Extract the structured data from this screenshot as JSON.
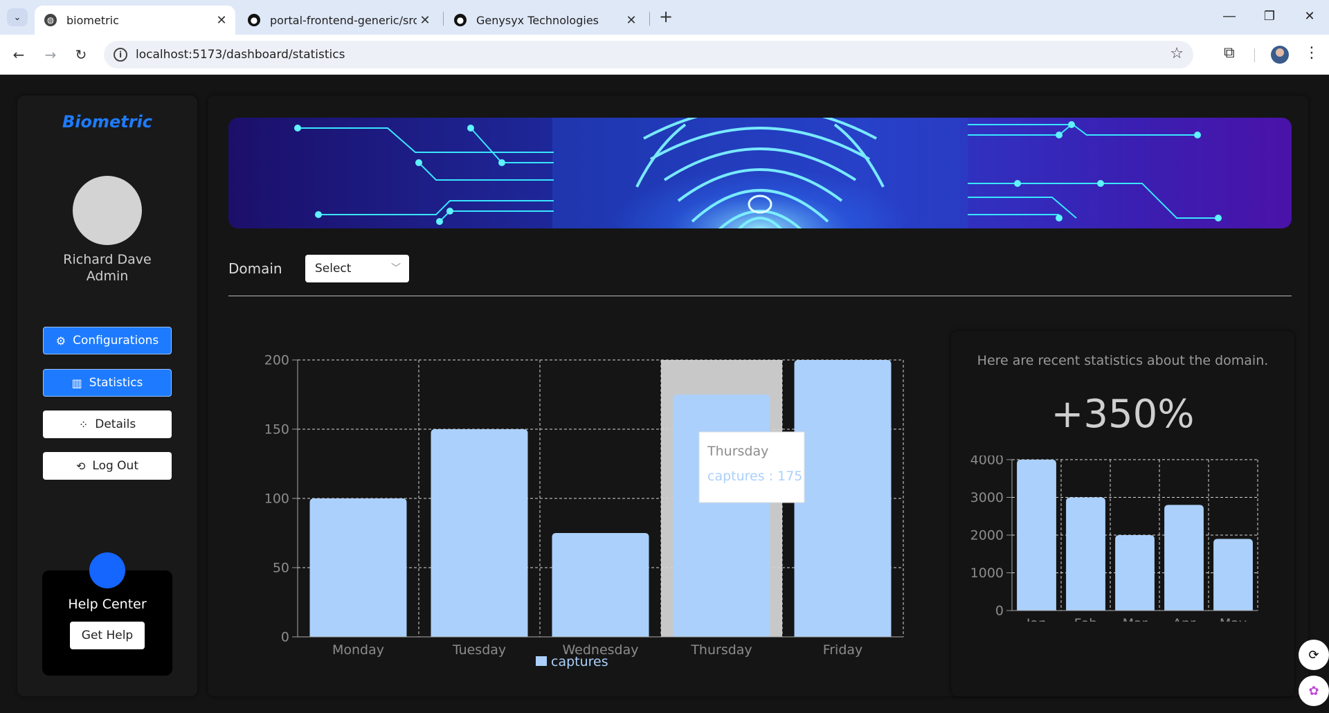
{
  "browser": {
    "tabs": [
      {
        "title": "biometric",
        "active": true
      },
      {
        "title": "portal-frontend-generic/src/pa",
        "active": false
      },
      {
        "title": "Genysyx Technologies",
        "active": false
      }
    ],
    "url": "localhost:5173/dashboard/statistics"
  },
  "sidebar": {
    "brand": "Biometric",
    "user_name": "Richard Dave",
    "user_role": "Admin",
    "nav": [
      {
        "label": "Configurations",
        "icon": "gear-icon",
        "active": true
      },
      {
        "label": "Statistics",
        "icon": "bar-chart-icon",
        "active": true
      },
      {
        "label": "Details",
        "icon": "dots-icon",
        "active": false
      },
      {
        "label": "Log Out",
        "icon": "logout-icon",
        "active": false
      }
    ],
    "help": {
      "title": "Help Center",
      "button": "Get Help"
    }
  },
  "filters": {
    "domain_label": "Domain",
    "domain_select": "Select"
  },
  "stats": {
    "description": "Here are recent statistics about the domain.",
    "percentage": "+350%"
  },
  "tooltip": {
    "title": "Thursday",
    "text": "captures : 175"
  },
  "colors": {
    "bar": "#abd0fb",
    "accent": "#1e7bff",
    "highlight": "#c8c8c8"
  },
  "chart_data": [
    {
      "type": "bar",
      "categories": [
        "Monday",
        "Tuesday",
        "Wednesday",
        "Thursday",
        "Friday"
      ],
      "series": [
        {
          "name": "captures",
          "values": [
            100,
            150,
            75,
            175,
            200
          ]
        }
      ],
      "ylim": [
        0,
        200
      ],
      "yticks": [
        0,
        50,
        100,
        150,
        200
      ],
      "grid": true,
      "legend": "bottom",
      "highlighted_category": "Thursday"
    },
    {
      "type": "bar",
      "categories": [
        "Jan",
        "Feb",
        "Mar",
        "Apr",
        "May"
      ],
      "series": [
        {
          "values": [
            4000,
            3000,
            2000,
            2800,
            1900
          ]
        }
      ],
      "ylim": [
        0,
        4000
      ],
      "yticks": [
        0,
        1000,
        2000,
        3000,
        4000
      ],
      "grid": true
    }
  ]
}
